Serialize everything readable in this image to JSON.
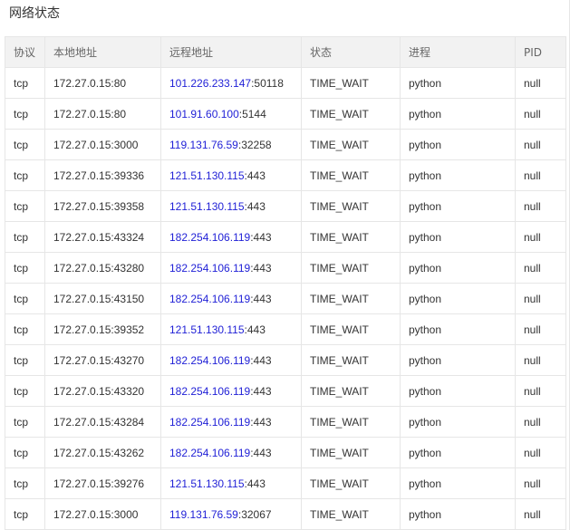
{
  "panel": {
    "title": "网络状态"
  },
  "table": {
    "headers": {
      "protocol": "协议",
      "local": "本地地址",
      "remote": "远程地址",
      "state": "状态",
      "process": "进程",
      "pid": "PID"
    },
    "rows": [
      {
        "protocol": "tcp",
        "local": "172.27.0.15:80",
        "remote_ip": "101.226.233.147",
        "remote_port": ":50118",
        "state": "TIME_WAIT",
        "process": "python",
        "pid": "null"
      },
      {
        "protocol": "tcp",
        "local": "172.27.0.15:80",
        "remote_ip": "101.91.60.100",
        "remote_port": ":5144",
        "state": "TIME_WAIT",
        "process": "python",
        "pid": "null"
      },
      {
        "protocol": "tcp",
        "local": "172.27.0.15:3000",
        "remote_ip": "119.131.76.59",
        "remote_port": ":32258",
        "state": "TIME_WAIT",
        "process": "python",
        "pid": "null"
      },
      {
        "protocol": "tcp",
        "local": "172.27.0.15:39336",
        "remote_ip": "121.51.130.115",
        "remote_port": ":443",
        "state": "TIME_WAIT",
        "process": "python",
        "pid": "null"
      },
      {
        "protocol": "tcp",
        "local": "172.27.0.15:39358",
        "remote_ip": "121.51.130.115",
        "remote_port": ":443",
        "state": "TIME_WAIT",
        "process": "python",
        "pid": "null"
      },
      {
        "protocol": "tcp",
        "local": "172.27.0.15:43324",
        "remote_ip": "182.254.106.119",
        "remote_port": ":443",
        "state": "TIME_WAIT",
        "process": "python",
        "pid": "null"
      },
      {
        "protocol": "tcp",
        "local": "172.27.0.15:43280",
        "remote_ip": "182.254.106.119",
        "remote_port": ":443",
        "state": "TIME_WAIT",
        "process": "python",
        "pid": "null"
      },
      {
        "protocol": "tcp",
        "local": "172.27.0.15:43150",
        "remote_ip": "182.254.106.119",
        "remote_port": ":443",
        "state": "TIME_WAIT",
        "process": "python",
        "pid": "null"
      },
      {
        "protocol": "tcp",
        "local": "172.27.0.15:39352",
        "remote_ip": "121.51.130.115",
        "remote_port": ":443",
        "state": "TIME_WAIT",
        "process": "python",
        "pid": "null"
      },
      {
        "protocol": "tcp",
        "local": "172.27.0.15:43270",
        "remote_ip": "182.254.106.119",
        "remote_port": ":443",
        "state": "TIME_WAIT",
        "process": "python",
        "pid": "null"
      },
      {
        "protocol": "tcp",
        "local": "172.27.0.15:43320",
        "remote_ip": "182.254.106.119",
        "remote_port": ":443",
        "state": "TIME_WAIT",
        "process": "python",
        "pid": "null"
      },
      {
        "protocol": "tcp",
        "local": "172.27.0.15:43284",
        "remote_ip": "182.254.106.119",
        "remote_port": ":443",
        "state": "TIME_WAIT",
        "process": "python",
        "pid": "null"
      },
      {
        "protocol": "tcp",
        "local": "172.27.0.15:43262",
        "remote_ip": "182.254.106.119",
        "remote_port": ":443",
        "state": "TIME_WAIT",
        "process": "python",
        "pid": "null"
      },
      {
        "protocol": "tcp",
        "local": "172.27.0.15:39276",
        "remote_ip": "121.51.130.115",
        "remote_port": ":443",
        "state": "TIME_WAIT",
        "process": "python",
        "pid": "null"
      },
      {
        "protocol": "tcp",
        "local": "172.27.0.15:3000",
        "remote_ip": "119.131.76.59",
        "remote_port": ":32067",
        "state": "TIME_WAIT",
        "process": "python",
        "pid": "null"
      }
    ]
  },
  "colors": {
    "remote_ip": "#1f1fd6",
    "header_bg": "#f2f2f2",
    "border": "#e6e6e6"
  }
}
